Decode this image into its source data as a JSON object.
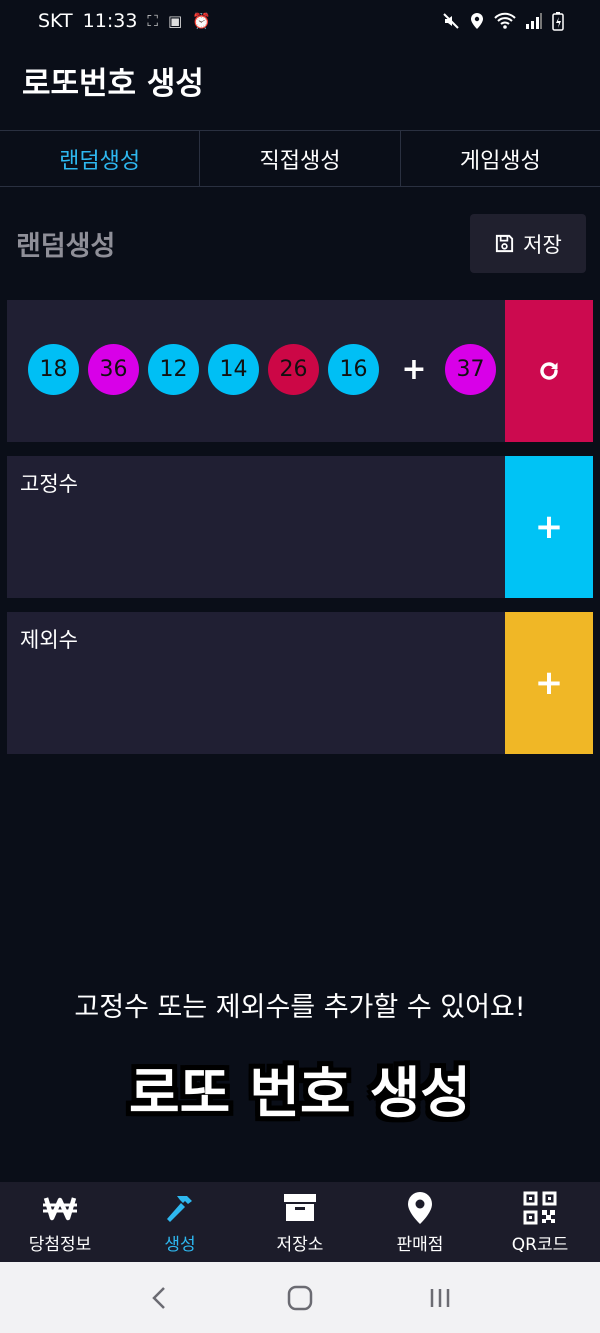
{
  "status_bar": {
    "carrier": "SKT",
    "time": "11:33"
  },
  "header": {
    "title": "로또번호 생성"
  },
  "tabs": [
    {
      "label": "랜덤생성",
      "active": true
    },
    {
      "label": "직접생성",
      "active": false
    },
    {
      "label": "게임생성",
      "active": false
    }
  ],
  "section": {
    "title": "랜덤생성",
    "save_label": "저장"
  },
  "numbers": {
    "main": [
      {
        "value": "18",
        "color": "#00bff5"
      },
      {
        "value": "36",
        "color": "#d800e8"
      },
      {
        "value": "12",
        "color": "#00bff5"
      },
      {
        "value": "14",
        "color": "#00bff5"
      },
      {
        "value": "26",
        "color": "#cc0746"
      },
      {
        "value": "16",
        "color": "#00bff5"
      }
    ],
    "plus": "+",
    "bonus": {
      "value": "37",
      "color": "#d800e8"
    }
  },
  "fixed": {
    "label": "고정수",
    "button": "+",
    "color": "#00c3f5"
  },
  "excluded": {
    "label": "제외수",
    "button": "+",
    "color": "#f0b726"
  },
  "refresh_color": "#cc0a4f",
  "hint": "고정수 또는 제외수를 추가할 수 있어요!",
  "caption": "로또 번호 생성",
  "bottom_nav": [
    {
      "label": "당첨정보",
      "icon": "won-icon",
      "active": false
    },
    {
      "label": "생성",
      "icon": "hammer-icon",
      "active": true
    },
    {
      "label": "저장소",
      "icon": "archive-icon",
      "active": false
    },
    {
      "label": "판매점",
      "icon": "location-pin-icon",
      "active": false
    },
    {
      "label": "QR코드",
      "icon": "qr-code-icon",
      "active": false
    }
  ]
}
